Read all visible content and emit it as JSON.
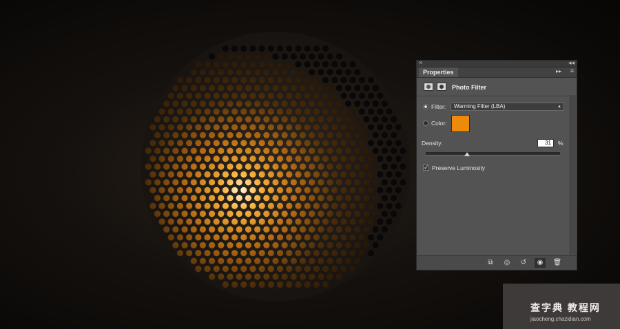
{
  "panel": {
    "close_glyph": "×",
    "collapse_glyph": "◂◂",
    "tab_label": "Properties",
    "flyout_glyph": "▸▸",
    "menu_glyph": "≡",
    "adjustment_title": "Photo Filter",
    "filter": {
      "label": "Filter:",
      "value": "Warming Filter (LBA)",
      "selected": true
    },
    "color": {
      "label": "Color:",
      "swatch_hex": "#ec8a0b",
      "selected": false
    },
    "density": {
      "label": "Density:",
      "value": "31",
      "unit": "%",
      "level_percent": 31
    },
    "preserve_luminosity": {
      "label": "Preserve Luminosity",
      "checked": true
    },
    "bottom_icons": [
      "clip-to-layer-icon",
      "view-previous-state-icon",
      "reset-icon",
      "visibility-eye-icon",
      "trash-icon"
    ]
  },
  "canvas": {
    "light_color": "#f5a623",
    "background_color": "#0d0b09"
  },
  "watermark": {
    "line1": "查字典 教程网",
    "line2": "jiaocheng.chazidian.com"
  }
}
